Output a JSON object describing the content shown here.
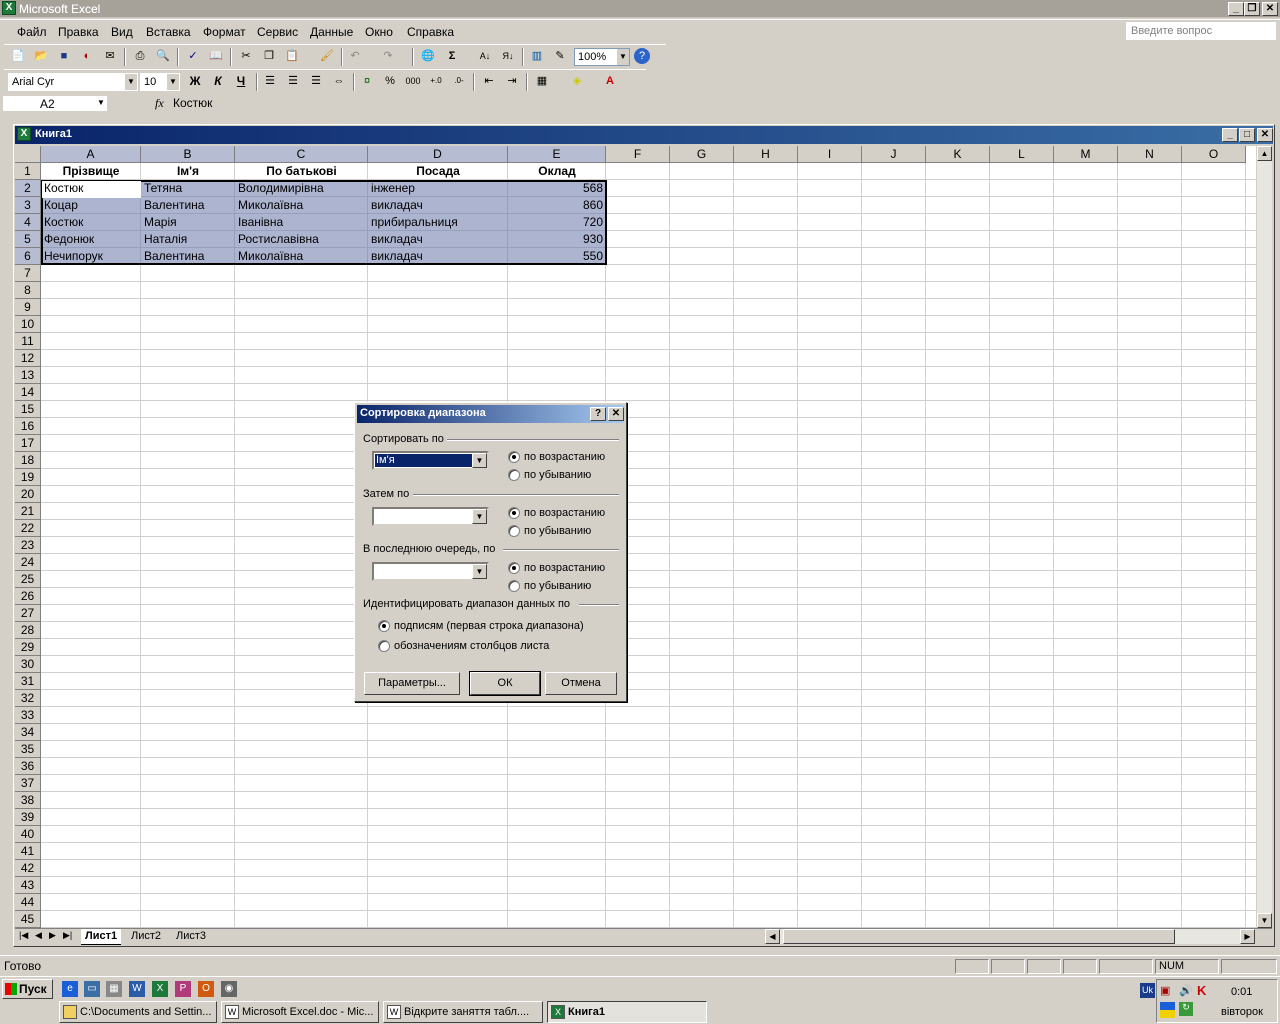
{
  "app": {
    "title": "Microsoft Excel",
    "ask_placeholder": "Введите вопрос"
  },
  "menu": [
    "Файл",
    "Правка",
    "Вид",
    "Вставка",
    "Формат",
    "Сервис",
    "Данные",
    "Окно",
    "Справка"
  ],
  "toolbar": {
    "zoom": "100%",
    "font": "Arial Cyr",
    "size": "10",
    "bold": "Ж",
    "italic": "К",
    "underline": "Ч",
    "percent": "%",
    "thousands": "000",
    "sigma": "Σ"
  },
  "formula_bar": {
    "name_box": "A2",
    "fx": "fx",
    "value": "Костюк"
  },
  "workbook": {
    "title": "Книга1"
  },
  "columns": [
    "A",
    "B",
    "C",
    "D",
    "E",
    "F",
    "G",
    "H",
    "I",
    "J",
    "K",
    "L",
    "M",
    "N",
    "O"
  ],
  "rows": [
    "1",
    "2",
    "3",
    "4",
    "5",
    "6",
    "7",
    "8",
    "9",
    "10",
    "11",
    "12",
    "13",
    "14",
    "15",
    "16",
    "17",
    "18",
    "19",
    "20",
    "21",
    "22",
    "23",
    "24",
    "25",
    "26",
    "27",
    "28",
    "29",
    "30",
    "31",
    "32",
    "33",
    "34",
    "35",
    "36",
    "37",
    "38",
    "39",
    "40",
    "41",
    "42",
    "43",
    "44",
    "45"
  ],
  "table": {
    "headers": [
      "Прізвище",
      "Ім'я",
      "По батькові",
      "Посада",
      "Оклад"
    ],
    "rows": [
      [
        "Костюк",
        "Тетяна",
        "Володимирівна",
        "інженер",
        "568"
      ],
      [
        "Коцар",
        "Валентина",
        "Миколаївна",
        "викладач",
        "860"
      ],
      [
        "Костюк",
        "Марія",
        "Іванівна",
        "прибиральниця",
        "720"
      ],
      [
        "Федонюк",
        "Наталія",
        "Ростиславівна",
        "викладач",
        "930"
      ],
      [
        "Нечипорук",
        "Валентина",
        "Миколаївна",
        "викладач",
        "550"
      ]
    ]
  },
  "sheets": [
    "Лист1",
    "Лист2",
    "Лист3"
  ],
  "dialog": {
    "title": "Сортировка диапазона",
    "sort_by": "Сортировать по",
    "sort_by_value": "Ім'я",
    "then_by": "Затем по",
    "last_by": "В последнюю очередь, по",
    "asc": "по возрастанию",
    "desc": "по убыванию",
    "identify": "Идентифицировать диапазон данных по",
    "opt_labels": "подписям (первая строка диапазона)",
    "opt_columns": "обозначениям столбцов листа",
    "btn_params": "Параметры...",
    "btn_ok": "ОК",
    "btn_cancel": "Отмена"
  },
  "status": {
    "ready": "Готово",
    "num": "NUM"
  },
  "taskbar": {
    "start": "Пуск",
    "tasks": [
      "C:\\Documents and Settin...",
      "Microsoft Excel.doc - Mic...",
      "Відкрите заняття табл....",
      "Книга1"
    ],
    "lang": "Uk",
    "time": "0:01",
    "day": "вівторок"
  }
}
